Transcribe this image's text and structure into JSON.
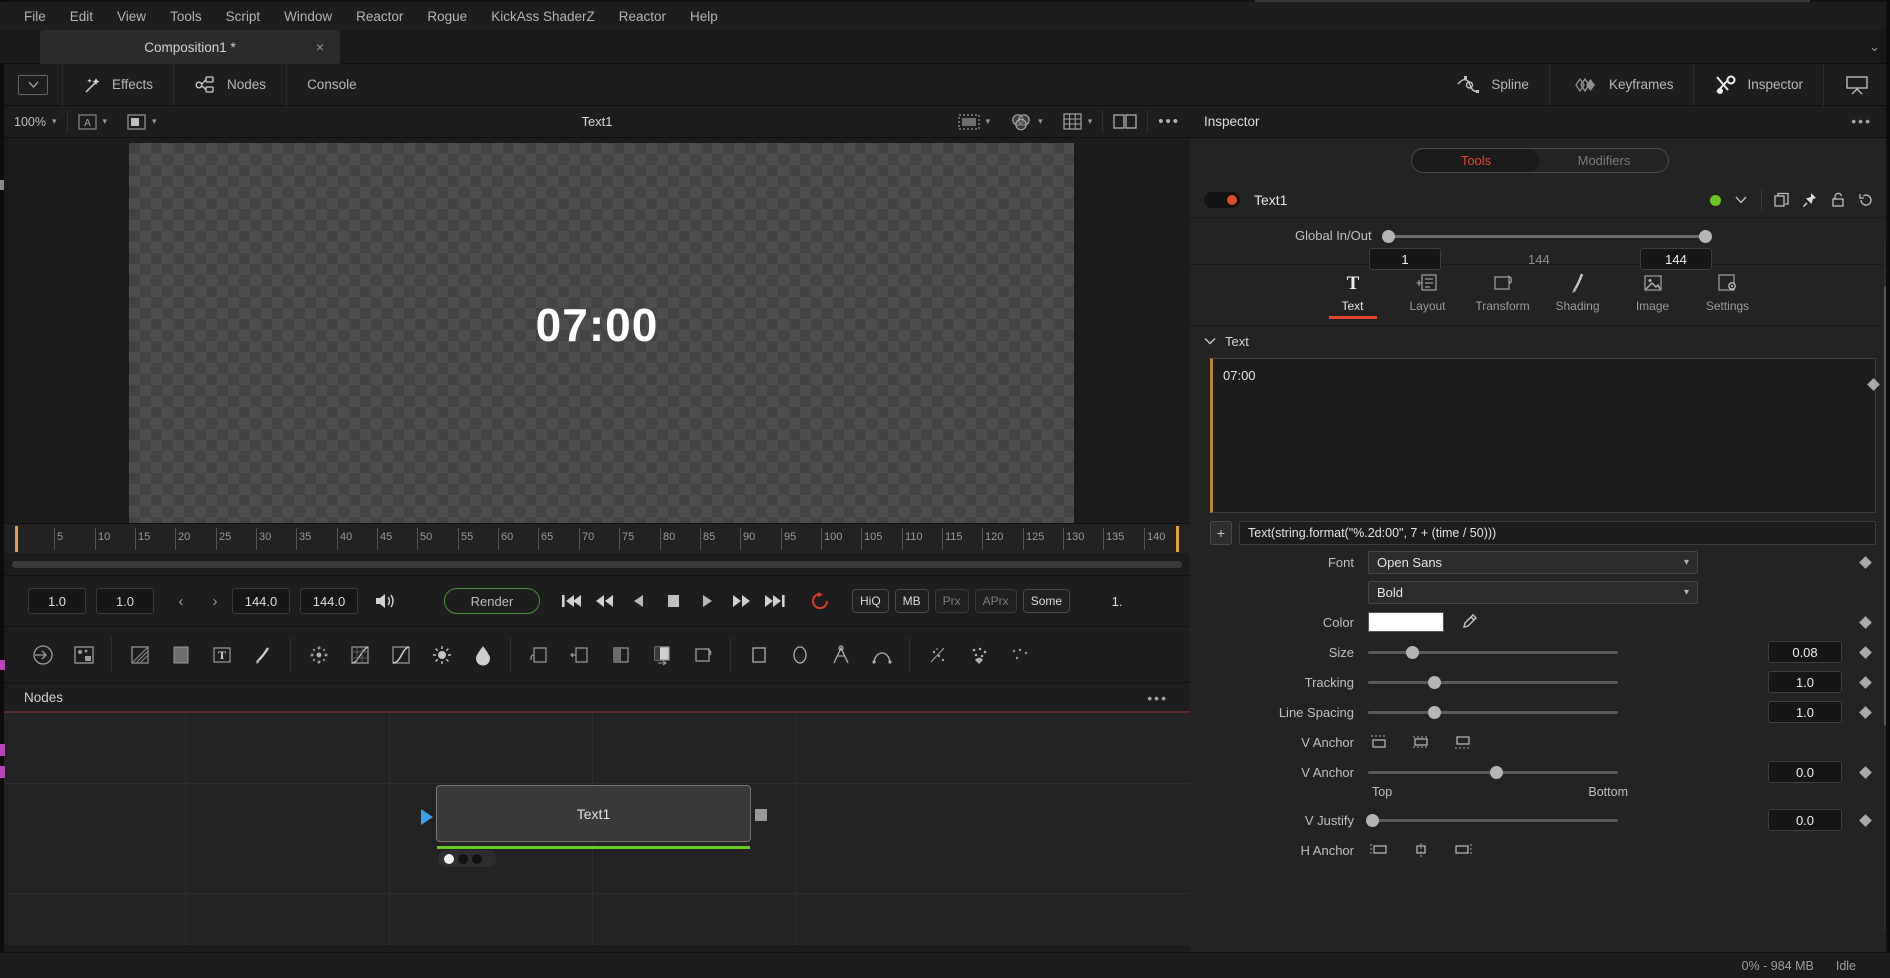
{
  "menubar": {
    "items": [
      "File",
      "Edit",
      "View",
      "Tools",
      "Script",
      "Window",
      "Reactor",
      "Rogue",
      "KickAss ShaderZ",
      "Reactor",
      "Help"
    ]
  },
  "tabbar": {
    "comp_tab_label": "Composition1 *",
    "close_glyph": "×",
    "caret_glyph": "⌄"
  },
  "toolrow": {
    "left_buttons": [
      {
        "label": "Effects",
        "icon": "magic-wand-icon"
      },
      {
        "label": "Nodes",
        "icon": "nodes-icon"
      },
      {
        "label": "Console",
        "icon": "console-icon"
      }
    ],
    "right_buttons": [
      {
        "label": "Spline",
        "icon": "spline-icon"
      },
      {
        "label": "Keyframes",
        "icon": "keyframes-icon"
      },
      {
        "label": "Inspector",
        "icon": "inspector-icon"
      }
    ]
  },
  "viewer": {
    "zoom_level": "100%",
    "channel_label": "A",
    "title": "Text1",
    "timecode_display": "07:00"
  },
  "timeline": {
    "tick_labels": [
      "5",
      "10",
      "15",
      "20",
      "25",
      "30",
      "35",
      "40",
      "45",
      "50",
      "55",
      "60",
      "65",
      "70",
      "75",
      "80",
      "85",
      "90",
      "95",
      "100",
      "105",
      "110",
      "115",
      "120",
      "125",
      "130",
      "135",
      "140"
    ]
  },
  "transport": {
    "field_in": "1.0",
    "field_current": "1.0",
    "field_out": "144.0",
    "field_total": "144.0",
    "render_label": "Render",
    "quality_buttons": [
      {
        "label": "HiQ",
        "active": true
      },
      {
        "label": "MB",
        "active": true
      },
      {
        "label": "Prx",
        "active": false
      },
      {
        "label": "APrx",
        "active": false
      },
      {
        "label": "Some",
        "active": true
      }
    ],
    "trailing_value": "1."
  },
  "nodes_panel": {
    "title": "Nodes",
    "dots": "•••",
    "node_label": "Text1"
  },
  "inspector": {
    "title": "Inspector",
    "dots": "•••",
    "tabs": {
      "tools": "Tools",
      "modifiers": "Modifiers"
    },
    "node_name": "Text1",
    "global_in_out": {
      "label": "Global In/Out",
      "in_value": "1",
      "mid_value": "144",
      "out_value": "144"
    },
    "categories": [
      {
        "label": "Text",
        "icon": "text-T-icon",
        "active": true
      },
      {
        "label": "Layout",
        "icon": "layout-icon",
        "active": false
      },
      {
        "label": "Transform",
        "icon": "transform-icon",
        "active": false
      },
      {
        "label": "Shading",
        "icon": "shading-brush-icon",
        "active": false
      },
      {
        "label": "Image",
        "icon": "image-icon",
        "active": false
      },
      {
        "label": "Settings",
        "icon": "settings-gear-icon",
        "active": false
      }
    ],
    "text_section": {
      "header": "Text",
      "textarea_value": "07:00",
      "expression": "Text(string.format(\"%.2d:00\", 7 + (time / 50)))",
      "expression_plus": "+"
    },
    "properties": [
      {
        "name": "font",
        "label": "Font",
        "type": "select",
        "value": "Open Sans"
      },
      {
        "name": "font-style",
        "label": "",
        "type": "select",
        "value": "Bold"
      },
      {
        "name": "color",
        "label": "Color",
        "type": "color",
        "value": "#ffffff"
      },
      {
        "name": "size",
        "label": "Size",
        "type": "slider",
        "value": "0.08",
        "handle_pct": 17
      },
      {
        "name": "tracking",
        "label": "Tracking",
        "type": "slider",
        "value": "1.0",
        "handle_pct": 26
      },
      {
        "name": "line-spacing",
        "label": "Line Spacing",
        "type": "slider",
        "value": "1.0",
        "handle_pct": 26
      },
      {
        "name": "v-anchor-icons",
        "label": "V Anchor",
        "type": "anchors"
      },
      {
        "name": "v-anchor",
        "label": "V Anchor",
        "type": "slider",
        "value": "0.0",
        "handle_pct": 51,
        "min_label": "Top",
        "max_label": "Bottom"
      },
      {
        "name": "v-justify",
        "label": "V Justify",
        "type": "slider",
        "value": "0.0",
        "handle_pct": 0
      },
      {
        "name": "h-anchor-icons",
        "label": "H Anchor",
        "type": "anchors"
      }
    ]
  },
  "statusbar": {
    "memory": "0% -  984 MB",
    "state": "Idle"
  }
}
